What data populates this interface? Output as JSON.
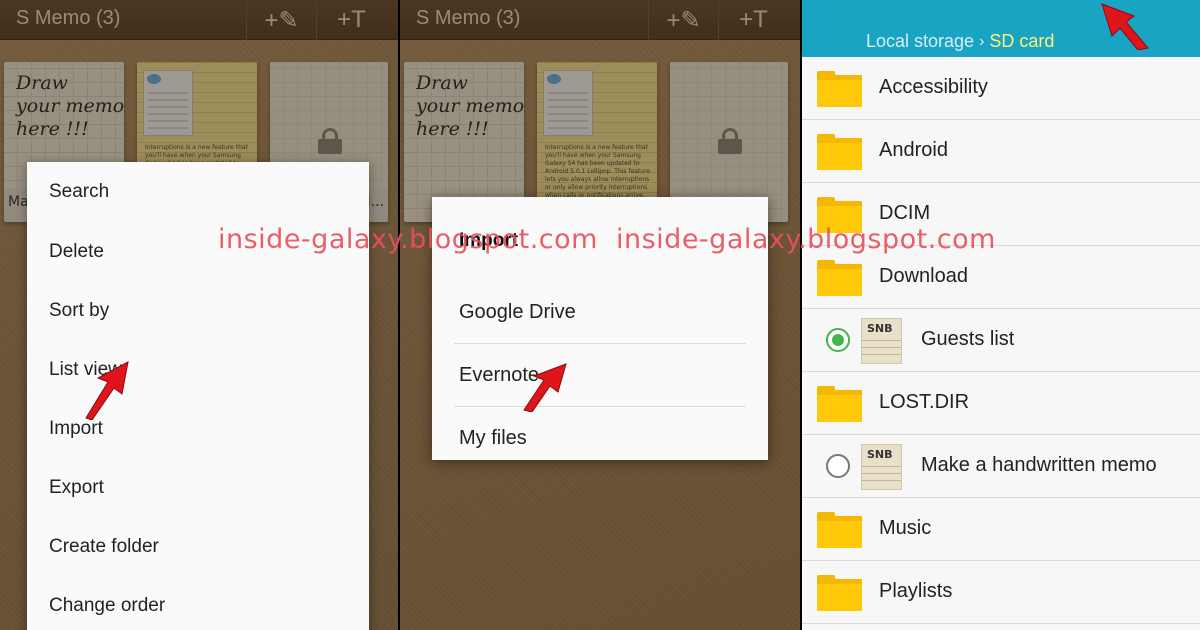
{
  "panel1": {
    "app_title": "S Memo (3)",
    "add_handwriting_label": "+✎",
    "add_text_label": "+T",
    "memos": [
      {
        "handwriting": "Draw\nyour memo\nhere !!!",
        "title": "Ma"
      },
      {
        "preview_text": "Interruptions is a new feature that you'll have when your Samsung Galaxy S4 has been updated to Android 5.0.1 Lollipop. This feature lets you always allow interruptions or only allow priority interruptions when calls or notifications arrive."
      },
      {
        "locked": true,
        "title": "d..."
      }
    ],
    "menu": [
      "Search",
      "Delete",
      "Sort by",
      "List view",
      "Import",
      "Export",
      "Create folder",
      "Change order"
    ]
  },
  "panel2": {
    "app_title": "S Memo (3)",
    "add_handwriting_label": "+✎",
    "add_text_label": "+T",
    "dialog": {
      "title": "Import",
      "options": [
        "Google Drive",
        "Evernote",
        "My files"
      ]
    }
  },
  "panel3": {
    "breadcrumb": {
      "parent": "Local storage",
      "current": "SD card"
    },
    "items": [
      {
        "type": "folder",
        "name": "Accessibility"
      },
      {
        "type": "folder",
        "name": "Android"
      },
      {
        "type": "folder",
        "name": "DCIM"
      },
      {
        "type": "folder",
        "name": "Download"
      },
      {
        "type": "file",
        "name": "Guests list",
        "ext": "SNB",
        "selected": true
      },
      {
        "type": "folder",
        "name": "LOST.DIR"
      },
      {
        "type": "file",
        "name": "Make a handwritten memo",
        "ext": "SNB",
        "selected": false
      },
      {
        "type": "folder",
        "name": "Music"
      },
      {
        "type": "folder",
        "name": "Playlists"
      }
    ]
  },
  "watermark": "inside-galaxy.blogspot.com",
  "colors": {
    "fm_header": "#1aa4c4",
    "breadcrumb_current": "#fff27a",
    "folder": "#ffc90a",
    "radio_checked": "#43b649",
    "watermark": "#e8505a",
    "arrow": "#e0141b"
  }
}
